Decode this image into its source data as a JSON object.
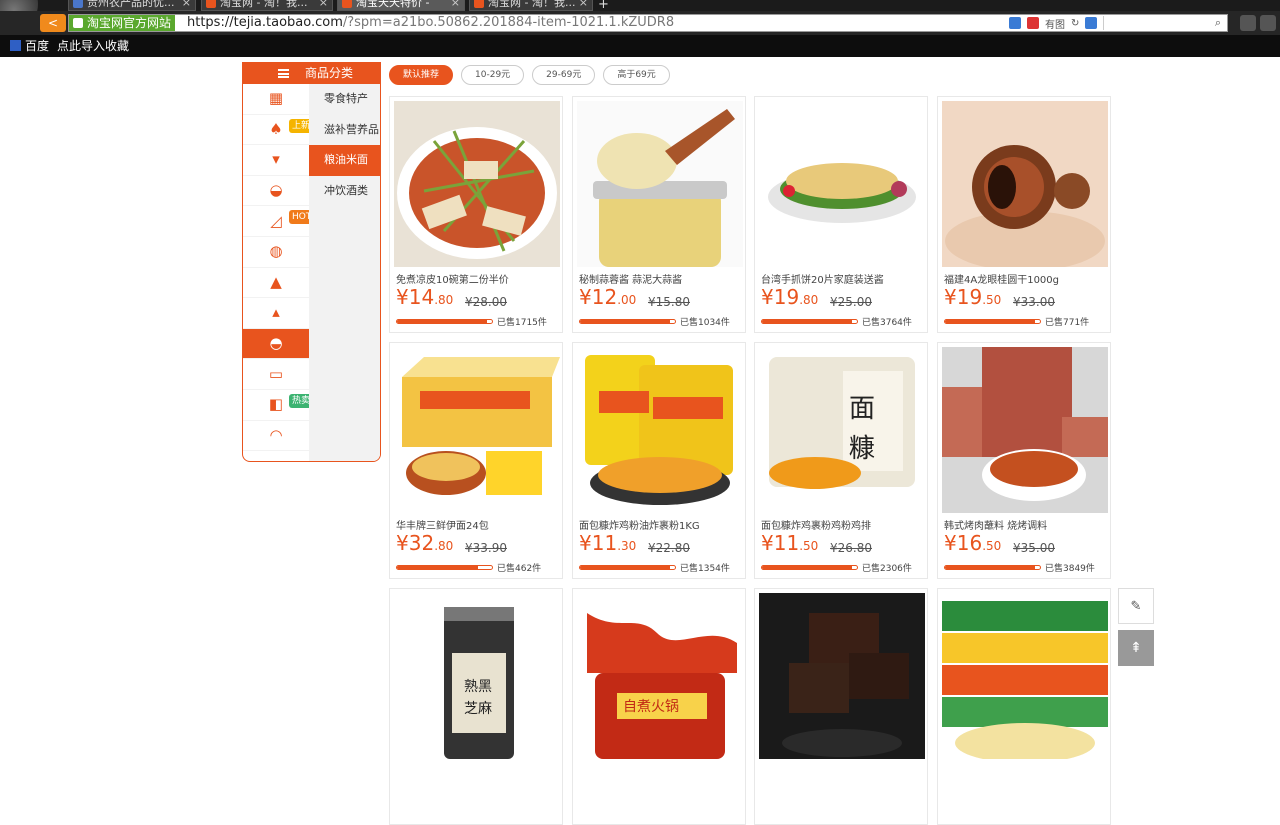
{
  "browser": {
    "tabs": [
      {
        "title": "贵州农产品的优..."
      },
      {
        "title": "淘宝网 - 淘！我..."
      },
      {
        "title": "淘宝天天特价 -"
      },
      {
        "title": "淘宝网 - 淘！我..."
      }
    ],
    "site_badge": "淘宝网官方网站",
    "url_main": "https://tejia.taobao.com",
    "url_rest": "/?spm=a21bo.50862.201884-item-1021.1.kZUDR8",
    "addr_tool_text": "有图"
  },
  "bookmarks": [
    {
      "label": "百度"
    },
    {
      "label": "点此导入收藏"
    }
  ],
  "category": {
    "header": "商品分类",
    "icons": [
      {
        "icon": "grid-icon",
        "glyph": "▦",
        "tag": ""
      },
      {
        "icon": "dress-icon",
        "glyph": "♠",
        "tag": "上新"
      },
      {
        "icon": "underwear-icon",
        "glyph": "▾",
        "tag": ""
      },
      {
        "icon": "bag-icon",
        "glyph": "◒",
        "tag": ""
      },
      {
        "icon": "heel-icon",
        "glyph": "◿",
        "tag": "HOT"
      },
      {
        "icon": "jacket-icon",
        "glyph": "◍",
        "tag": ""
      },
      {
        "icon": "bottle-icon",
        "glyph": "▲",
        "tag": ""
      },
      {
        "icon": "lamp-icon",
        "glyph": "▴",
        "tag": ""
      },
      {
        "icon": "burger-icon",
        "glyph": "◓",
        "tag": ""
      },
      {
        "icon": "monitor-icon",
        "glyph": "▭",
        "tag": ""
      },
      {
        "icon": "cup-icon",
        "glyph": "◧",
        "tag": "热卖"
      },
      {
        "icon": "helmet-icon",
        "glyph": "◠",
        "tag": ""
      }
    ],
    "subcategories": [
      "零食特产",
      "滋补营养品",
      "粮油米面",
      "冲饮酒类"
    ]
  },
  "filters": [
    "默认推荐",
    "10-29元",
    "29-69元",
    "高于69元"
  ],
  "products": [
    {
      "name": "免煮凉皮10碗第二份半价",
      "price_int": "14",
      "price_dec": ".80",
      "orig": "¥28.00",
      "sold": "已售1715件",
      "progress": 0.95
    },
    {
      "name": "秘制蒜蓉酱 蒜泥大蒜酱",
      "price_int": "12",
      "price_dec": ".00",
      "orig": "¥15.80",
      "sold": "已售1034件",
      "progress": 0.95
    },
    {
      "name": "台湾手抓饼20片家庭装送酱",
      "price_int": "19",
      "price_dec": ".80",
      "orig": "¥25.00",
      "sold": "已售3764件",
      "progress": 0.95
    },
    {
      "name": "福建4A龙眼桂圆干1000g",
      "price_int": "19",
      "price_dec": ".50",
      "orig": "¥33.00",
      "sold": "已售771件",
      "progress": 0.95
    },
    {
      "name": "华丰牌三鲜伊面24包",
      "price_int": "32",
      "price_dec": ".80",
      "orig": "¥33.90",
      "sold": "已售462件",
      "progress": 0.85
    },
    {
      "name": "面包糠炸鸡粉油炸裹粉1KG",
      "price_int": "11",
      "price_dec": ".30",
      "orig": "¥22.80",
      "sold": "已售1354件",
      "progress": 0.95
    },
    {
      "name": "面包糠炸鸡裹粉鸡粉鸡排",
      "price_int": "11",
      "price_dec": ".50",
      "orig": "¥26.80",
      "sold": "已售2306件",
      "progress": 0.95
    },
    {
      "name": "韩式烤肉蘸料 烧烤调料",
      "price_int": "16",
      "price_dec": ".50",
      "orig": "¥35.00",
      "sold": "已售3849件",
      "progress": 0.95
    },
    {
      "name": "",
      "price_int": "",
      "price_dec": "",
      "orig": "",
      "sold": "",
      "progress": 0
    },
    {
      "name": "",
      "price_int": "",
      "price_dec": "",
      "orig": "",
      "sold": "",
      "progress": 0
    },
    {
      "name": "",
      "price_int": "",
      "price_dec": "",
      "orig": "",
      "sold": "",
      "progress": 0
    },
    {
      "name": "",
      "price_int": "",
      "price_dec": "",
      "orig": "",
      "sold": "",
      "progress": 0
    }
  ],
  "product_art": [
    "liangpi",
    "garlic",
    "pancake",
    "longan",
    "noodles",
    "crumbs-a",
    "crumbs-b",
    "bbq",
    "sesame",
    "hotpot",
    "brownsugar",
    "packs"
  ],
  "currency": "¥",
  "colors": {
    "accent": "#e8541e",
    "sidebar_bg": "#f2f2f2"
  }
}
